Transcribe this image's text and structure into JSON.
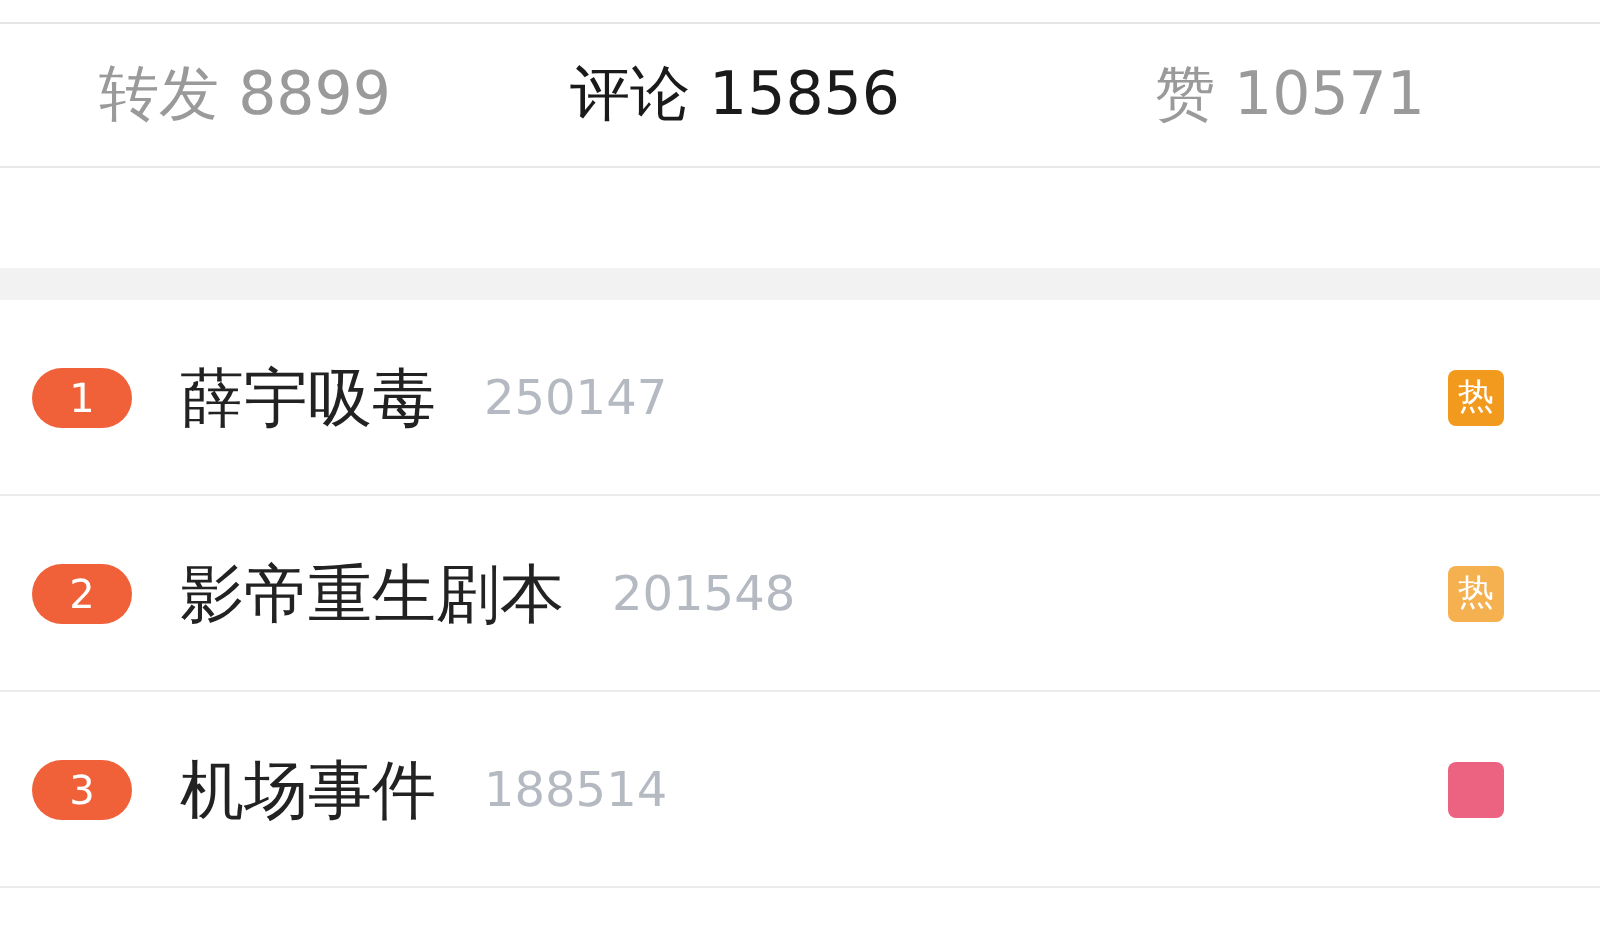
{
  "stats": [
    {
      "label": "转发 8899",
      "selected": false
    },
    {
      "label": "评论 15856",
      "selected": true
    },
    {
      "label": "赞 10571",
      "selected": false
    }
  ],
  "hot_list": [
    {
      "rank": "1",
      "title": "薛宇吸毒",
      "count": "250147",
      "badge": "热",
      "color": "#f29a1e"
    },
    {
      "rank": "2",
      "title": "影帝重生剧本",
      "count": "201548",
      "badge": "热",
      "color": "#f5b04f"
    },
    {
      "rank": "3",
      "title": "机场事件",
      "count": "188514",
      "color": "#ec6381"
    }
  ]
}
